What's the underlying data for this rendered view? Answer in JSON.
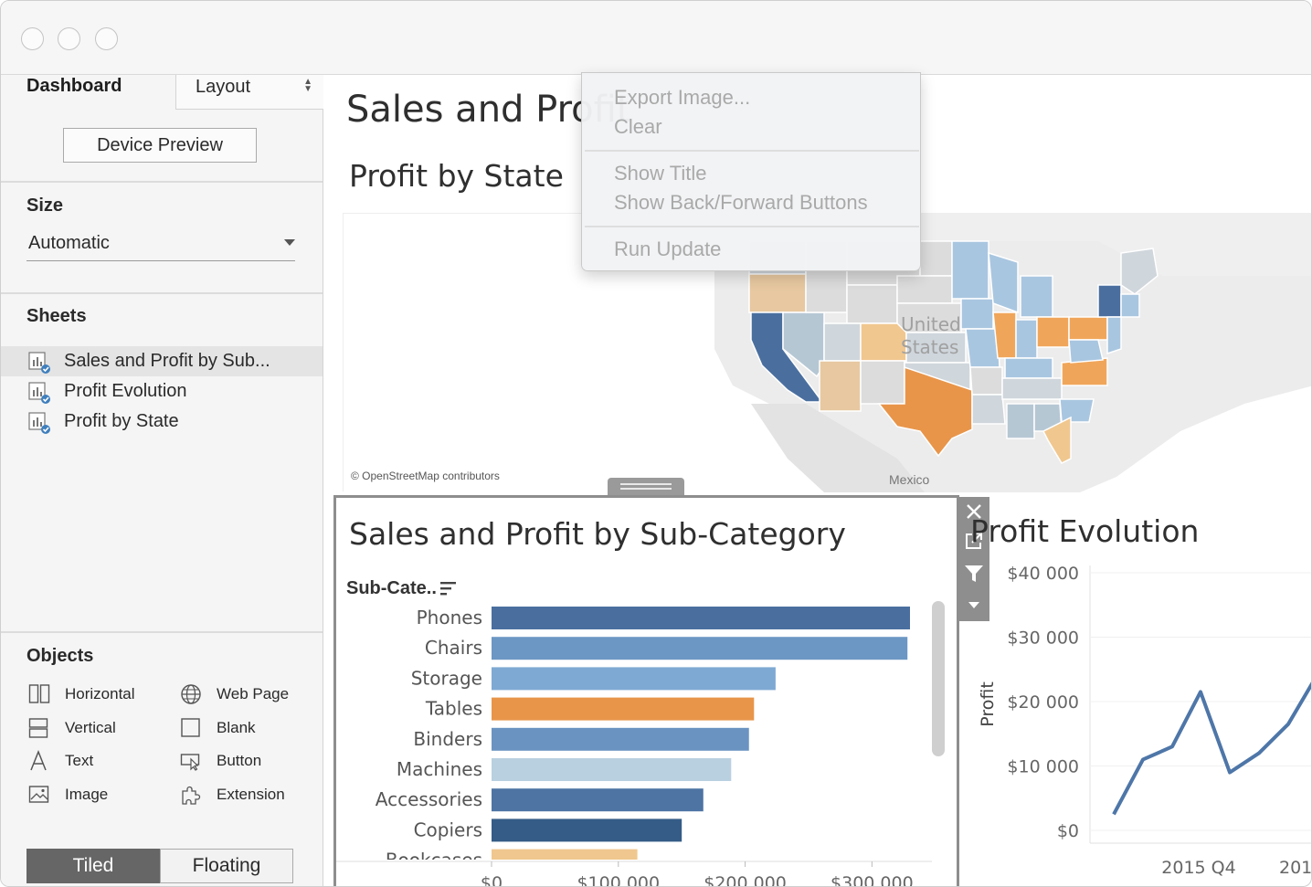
{
  "sidebar": {
    "tab_dashboard": "Dashboard",
    "tab_layout": "Layout",
    "device_preview": "Device Preview",
    "size": {
      "title": "Size",
      "value": "Automatic"
    },
    "sheets": {
      "title": "Sheets",
      "items": [
        {
          "label": "Sales and Profit by Sub..."
        },
        {
          "label": "Profit Evolution"
        },
        {
          "label": "Profit by State"
        }
      ]
    },
    "objects": {
      "title": "Objects",
      "items": [
        {
          "label": "Horizontal",
          "icon": "horizontal-icon"
        },
        {
          "label": "Web Page",
          "icon": "globe-icon"
        },
        {
          "label": "Vertical",
          "icon": "vertical-icon"
        },
        {
          "label": "Blank",
          "icon": "blank-icon"
        },
        {
          "label": "Text",
          "icon": "text-icon"
        },
        {
          "label": "Button",
          "icon": "button-icon"
        },
        {
          "label": "Image",
          "icon": "image-icon"
        },
        {
          "label": "Extension",
          "icon": "puzzle-icon"
        }
      ]
    },
    "tiled": "Tiled",
    "floating": "Floating"
  },
  "dashboard": {
    "title": "Sales and Profit",
    "map": {
      "title": "Profit by State",
      "credit": "© OpenStreetMap contributors",
      "country_label_1": "United",
      "country_label_2": "States",
      "mexico": "Mexico"
    },
    "bar_panel": {
      "title": "Sales and Profit by Sub-Category",
      "header": "Sub-Cate.."
    },
    "evolution": {
      "title": "Profit Evolution"
    }
  },
  "context_menu": {
    "items": [
      "Export Image...",
      "Clear",
      "Show Title",
      "Show Back/Forward Buttons",
      "Run Update"
    ]
  },
  "colors": {
    "dark_blue": "#4a6f9f",
    "mid_blue": "#6c97c4",
    "light_blue": "#a9c6e0",
    "pale_blue": "#b9d0e0",
    "orange": "#e8954a",
    "pale_orange": "#f0c78f",
    "navy": "#355c87"
  },
  "chart_data": [
    {
      "type": "bar",
      "categories": [
        "Phones",
        "Chairs",
        "Storage",
        "Tables",
        "Binders",
        "Machines",
        "Accessories",
        "Copiers",
        "Bookcases"
      ],
      "values": [
        330000,
        328000,
        224000,
        207000,
        203000,
        189000,
        167000,
        150000,
        115000
      ],
      "colors": [
        "#4a6f9f",
        "#6c97c4",
        "#7ea9d3",
        "#e8954a",
        "#6a93c2",
        "#b9d0e0",
        "#4e74a4",
        "#355c87",
        "#f0c78f"
      ],
      "xlim": [
        0,
        350000
      ],
      "xticks": [
        "$0",
        "$100 000",
        "$200 000",
        "$300 000"
      ],
      "xtick_values": [
        0,
        100000,
        200000,
        300000
      ]
    },
    {
      "type": "line",
      "ylabel": "Profit",
      "yticks": [
        "$40 000",
        "$30 000",
        "$20 000",
        "$10 000",
        "$0"
      ],
      "ytick_values": [
        40000,
        30000,
        20000,
        10000,
        0
      ],
      "ylim": [
        0,
        40000
      ],
      "xticks": [
        "2015 Q4",
        "201"
      ],
      "series": [
        {
          "values": [
            2500,
            11000,
            13000,
            21500,
            9000,
            12000,
            16500,
            23000
          ]
        }
      ]
    }
  ]
}
